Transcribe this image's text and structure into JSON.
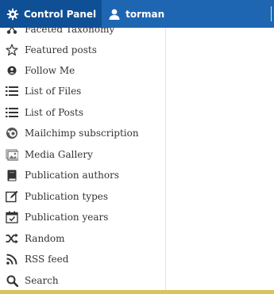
{
  "topbar": {
    "control_panel_label": "Control Panel",
    "user_label": "torman",
    "colors": {
      "bar": "#1e66b1",
      "active": "#0f4f95"
    }
  },
  "menu": {
    "items": [
      {
        "label": "Faceted Taxonomy",
        "icon": "taxonomy-icon"
      },
      {
        "label": "Featured posts",
        "icon": "star-icon"
      },
      {
        "label": "Follow Me",
        "icon": "follow-icon"
      },
      {
        "label": "List of Files",
        "icon": "list-icon"
      },
      {
        "label": "List of Posts",
        "icon": "list-icon"
      },
      {
        "label": "Mailchimp subscription",
        "icon": "mailchimp-icon"
      },
      {
        "label": "Media Gallery",
        "icon": "gallery-icon"
      },
      {
        "label": "Publication authors",
        "icon": "book-icon"
      },
      {
        "label": "Publication types",
        "icon": "edit-icon"
      },
      {
        "label": "Publication years",
        "icon": "calendar-icon"
      },
      {
        "label": "Random",
        "icon": "shuffle-icon"
      },
      {
        "label": "RSS feed",
        "icon": "rss-icon"
      },
      {
        "label": "Search",
        "icon": "search-icon"
      }
    ]
  }
}
